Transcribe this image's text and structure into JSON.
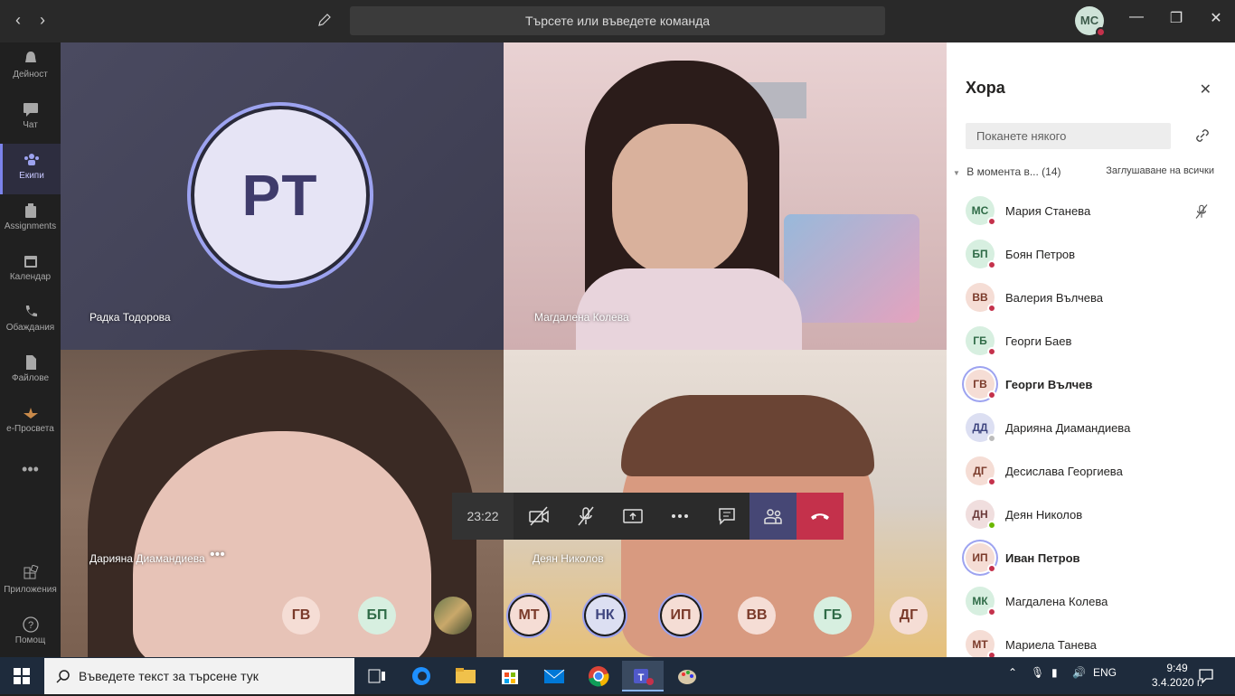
{
  "titlebar": {
    "search_placeholder": "Търсете или въведете команда",
    "user_initials": "МС"
  },
  "rail": [
    {
      "label": "Дейност",
      "icon": "bell-icon"
    },
    {
      "label": "Чат",
      "icon": "chat-icon"
    },
    {
      "label": "Екипи",
      "icon": "teams-icon",
      "active": true
    },
    {
      "label": "Assignments",
      "icon": "assignments-icon"
    },
    {
      "label": "Календар",
      "icon": "calendar-icon"
    },
    {
      "label": "Обаждания",
      "icon": "phone-icon"
    },
    {
      "label": "Файлове",
      "icon": "files-icon"
    },
    {
      "label": "e-Просвета",
      "icon": "eprosveta-icon"
    },
    {
      "label": "Приложения",
      "icon": "apps-icon"
    },
    {
      "label": "Помощ",
      "icon": "help-icon"
    }
  ],
  "stage": {
    "tiles": [
      {
        "name": "Радка Тодорова",
        "initials": "РТ"
      },
      {
        "name": "Магдалена Колева"
      },
      {
        "name": "Дарияна Диамандиева"
      },
      {
        "name": "Деян Николов"
      }
    ],
    "call_timer": "23:22",
    "strip": [
      {
        "initials": "ГВ",
        "bg": "#f5ddd5",
        "fg": "#7a3a2a"
      },
      {
        "initials": "БП",
        "bg": "#d7efe0",
        "fg": "#2f6b47"
      },
      {
        "initials": "",
        "photo": true
      },
      {
        "initials": "МТ",
        "bg": "#f5ddd5",
        "fg": "#7a3a2a",
        "ring": true
      },
      {
        "initials": "НК",
        "bg": "#dcdff2",
        "fg": "#3f4680",
        "ring": true
      },
      {
        "initials": "ИП",
        "bg": "#f5ddd5",
        "fg": "#7a3a2a",
        "ring": true
      },
      {
        "initials": "ВВ",
        "bg": "#f5ddd5",
        "fg": "#7a3a2a"
      },
      {
        "initials": "ГБ",
        "bg": "#d7efe0",
        "fg": "#2f6b47"
      },
      {
        "initials": "ДГ",
        "bg": "#f5ddd5",
        "fg": "#7a3a2a"
      }
    ]
  },
  "people_panel": {
    "title": "Хора",
    "invite_placeholder": "Поканете някого",
    "section_label": "В момента в...",
    "section_count": "(14)",
    "mute_all": "Заглушаване на всички",
    "people": [
      {
        "initials": "МС",
        "name": "Мария Станева",
        "bg": "#d7efe0",
        "fg": "#2f6b47",
        "status": "#c4314b"
      },
      {
        "initials": "БП",
        "name": "Боян Петров",
        "bg": "#d7efe0",
        "fg": "#2f6b47",
        "status": "#c4314b"
      },
      {
        "initials": "ВВ",
        "name": "Валерия Вълчева",
        "bg": "#f5ddd5",
        "fg": "#7a3a2a",
        "status": "#c4314b"
      },
      {
        "initials": "ГБ",
        "name": "Георги Баев",
        "bg": "#d7efe0",
        "fg": "#2f6b47",
        "status": "#c4314b"
      },
      {
        "initials": "ГВ",
        "name": "Георги Вълчев",
        "bg": "#f5ddd5",
        "fg": "#7a3a2a",
        "status": "#c4314b",
        "bold": true,
        "ring": true
      },
      {
        "initials": "ДД",
        "name": "Дарияна Диамандиева",
        "bg": "#dcdff2",
        "fg": "#3f4680",
        "status": "#bbbbbb"
      },
      {
        "initials": "ДГ",
        "name": "Десислава Георгиева",
        "bg": "#f5ddd5",
        "fg": "#7a3a2a",
        "status": "#c4314b"
      },
      {
        "initials": "ДН",
        "name": "Деян Николов",
        "bg": "#f0dede",
        "fg": "#6b3a3a",
        "status": "#6bb700"
      },
      {
        "initials": "ИП",
        "name": "Иван Петров",
        "bg": "#f5ddd5",
        "fg": "#7a3a2a",
        "status": "#c4314b",
        "bold": true,
        "ring": true
      },
      {
        "initials": "МК",
        "name": "Магдалена Колева",
        "bg": "#d7efe0",
        "fg": "#2f6b47",
        "status": "#c4314b"
      },
      {
        "initials": "МТ",
        "name": "Мариела Танева",
        "bg": "#f5ddd5",
        "fg": "#7a3a2a",
        "status": "#c4314b"
      }
    ]
  },
  "taskbar": {
    "search_placeholder": "Въведете текст за търсене тук",
    "language": "ENG",
    "time": "9:49",
    "date": "3.4.2020 г."
  },
  "colors": {
    "accent": "#7b83eb",
    "hangup": "#c4314b",
    "busy": "#c4314b",
    "available": "#6bb700"
  }
}
